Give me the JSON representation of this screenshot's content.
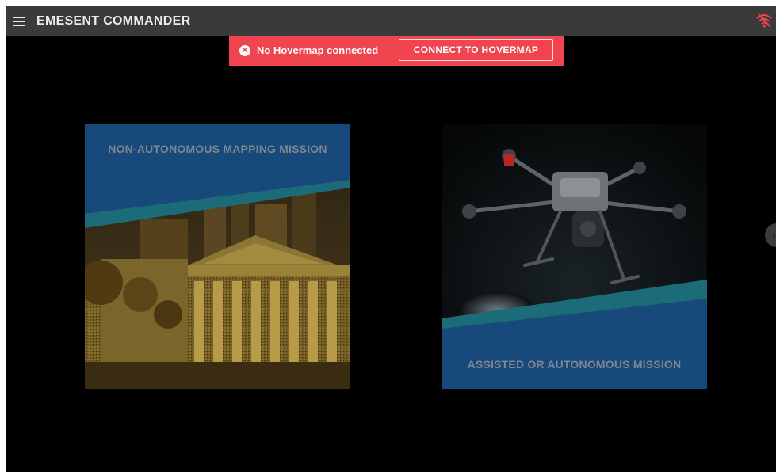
{
  "header": {
    "app_title": "EMESENT COMMANDER",
    "menu_icon": "hamburger-menu-icon",
    "status_icon": "wifi-off-icon"
  },
  "alert": {
    "icon": "x-circle-icon",
    "message": "No Hovermap connected",
    "button_label": "CONNECT TO HOVERMAP"
  },
  "cards": [
    {
      "title": "NON-AUTONOMOUS MAPPING MISSION",
      "image": "building-point-cloud"
    },
    {
      "title": "ASSISTED OR AUTONOMOUS MISSION",
      "image": "drone-with-lidar"
    }
  ],
  "colors": {
    "topbar": "#3a3a3a",
    "alert": "#f0444e",
    "card_blue": "#17497a",
    "card_teal": "#1b6c78",
    "wifi_off": "#f0444e"
  }
}
